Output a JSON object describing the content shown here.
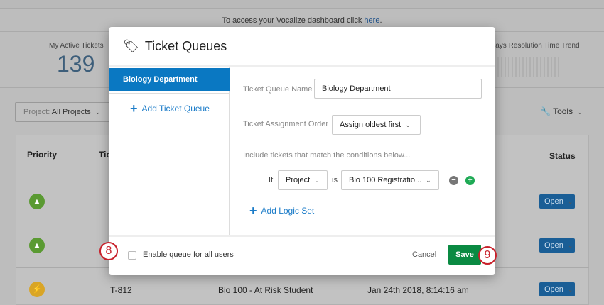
{
  "banner": {
    "text": "To access your Vocalize dashboard click ",
    "link": "here",
    "period": "."
  },
  "stats": {
    "active_label": "My Active Tickets",
    "active_value": "139",
    "trend_label": "Days Resolution Time Trend"
  },
  "toolbar": {
    "project_label": "Project:",
    "project_value": "All Projects",
    "tools_label": "Tools"
  },
  "table": {
    "headers": {
      "priority": "Priority",
      "ticket": "Tic",
      "status": "Status"
    },
    "rows": [
      {
        "priority_color": "#5a9a32",
        "ticket": "",
        "name": "",
        "date": "",
        "status": "Open"
      },
      {
        "priority_color": "#5a9a32",
        "ticket": "",
        "name": "",
        "date": "",
        "status": "Open"
      },
      {
        "priority_color": "#d9a526",
        "ticket": "T-812",
        "name": "Bio 100 - At Risk Student",
        "date": "Jan 24th 2018, 8:14:16 am",
        "status": "Open"
      }
    ]
  },
  "modal": {
    "title": "Ticket Queues",
    "queues": [
      {
        "label": "Biology Department",
        "active": true
      }
    ],
    "add_queue_label": "Add Ticket Queue",
    "name_label": "Ticket Queue Name",
    "name_value": "Biology Department",
    "order_label": "Ticket Assignment Order",
    "order_value": "Assign oldest first",
    "conditions_label": "Include tickets that match the conditions below...",
    "condition": {
      "if": "If",
      "field": "Project",
      "op": "is",
      "value": "Bio 100 Registratio..."
    },
    "add_logic_label": "Add Logic Set",
    "enable_label": "Enable queue for all users",
    "cancel_label": "Cancel",
    "save_label": "Save"
  },
  "callouts": {
    "enable": "8",
    "save": "9"
  }
}
